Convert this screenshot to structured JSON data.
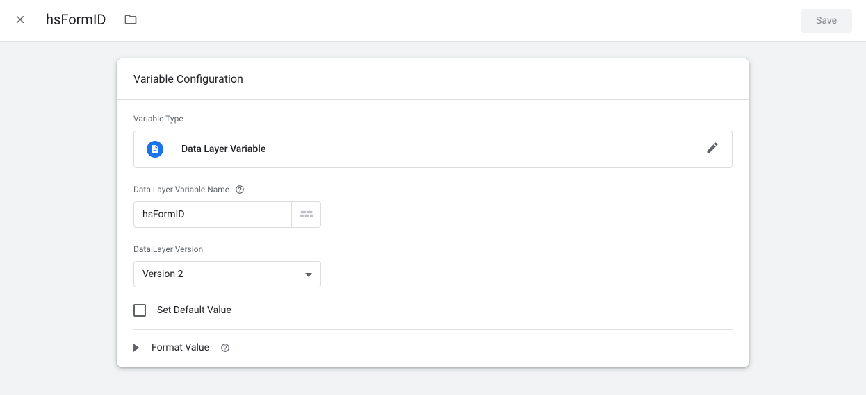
{
  "header": {
    "title_value": "hsFormID",
    "save_label": "Save"
  },
  "card": {
    "title": "Variable Configuration",
    "variable_type_label": "Variable Type",
    "variable_type_value": "Data Layer Variable",
    "dlv_name_label": "Data Layer Variable Name",
    "dlv_name_value": "hsFormID",
    "dlv_version_label": "Data Layer Version",
    "dlv_version_value": "Version 2",
    "set_default_label": "Set Default Value",
    "format_value_label": "Format Value"
  }
}
